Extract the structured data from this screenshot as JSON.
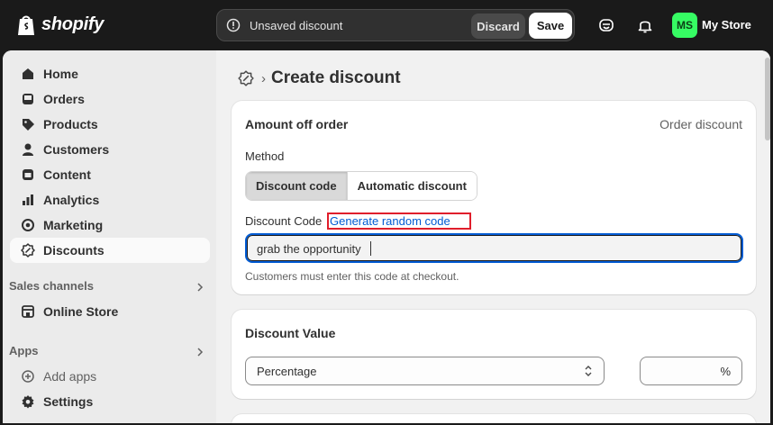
{
  "brand": {
    "logo_text": "shopify"
  },
  "savebar": {
    "title": "Unsaved discount",
    "discard_label": "Discard",
    "save_label": "Save"
  },
  "account": {
    "avatar_initials": "MS",
    "store_name": "My Store"
  },
  "sidebar": {
    "items": [
      {
        "label": "Home",
        "icon": "home-icon"
      },
      {
        "label": "Orders",
        "icon": "inbox-icon"
      },
      {
        "label": "Products",
        "icon": "tag-icon"
      },
      {
        "label": "Customers",
        "icon": "person-icon"
      },
      {
        "label": "Content",
        "icon": "image-icon"
      },
      {
        "label": "Analytics",
        "icon": "bar-chart-icon"
      },
      {
        "label": "Marketing",
        "icon": "target-icon"
      },
      {
        "label": "Discounts",
        "icon": "discount-icon",
        "active": true
      }
    ],
    "sales_channels": {
      "heading": "Sales channels",
      "items": [
        {
          "label": "Online Store",
          "icon": "store-icon"
        }
      ]
    },
    "apps": {
      "heading": "Apps",
      "items": [
        {
          "label": "Add apps",
          "icon": "plus-circle-icon"
        }
      ]
    },
    "settings": {
      "label": "Settings",
      "icon": "gear-icon"
    }
  },
  "page": {
    "title": "Create discount"
  },
  "method_card": {
    "title": "Amount off order",
    "aside": "Order discount",
    "method_label": "Method",
    "method_options": [
      "Discount code",
      "Automatic discount"
    ],
    "selected_method": "Discount code",
    "code_label": "Discount Code",
    "generate_link": "Generate random code",
    "code_value": "grab the opportunity",
    "help_text": "Customers must enter this code at checkout."
  },
  "value_card": {
    "title": "Discount Value",
    "type_value": "Percentage",
    "amount_value": "",
    "amount_suffix": "%"
  },
  "colors": {
    "accent": "#005bd3",
    "highlight": "#e01e2b",
    "avatar": "#36fb63"
  }
}
